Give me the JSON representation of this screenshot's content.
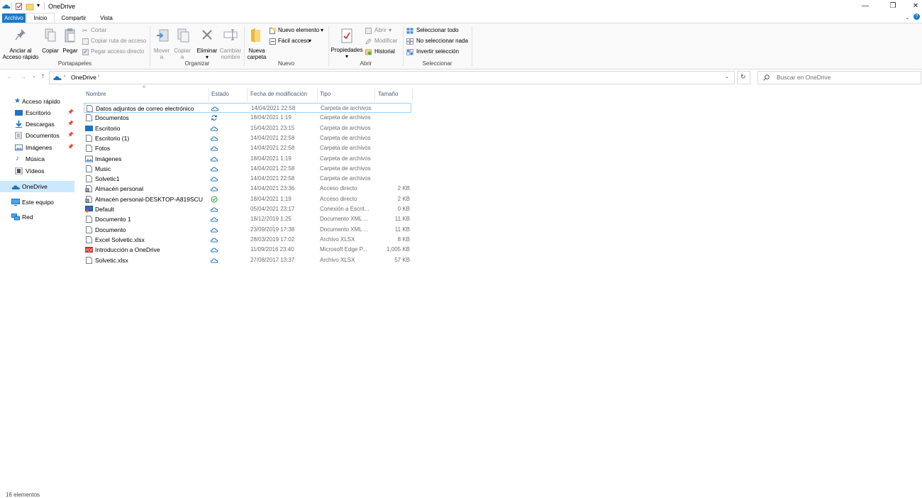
{
  "window": {
    "title": "OneDrive"
  },
  "tabs": {
    "file": "Archivo",
    "home": "Inicio",
    "share": "Compartir",
    "view": "Vista"
  },
  "ribbon": {
    "clipboard": {
      "label": "Portapapeles",
      "pin_line1": "Anclar al",
      "pin_line2": "Acceso rápido",
      "copy": "Copiar",
      "paste": "Pegar",
      "cut": "Cortar",
      "copy_path": "Copiar ruta de acceso",
      "paste_shortcut": "Pegar acceso directo"
    },
    "organize": {
      "label": "Organizar",
      "move_line1": "Mover",
      "move_line2": "a",
      "copy_line1": "Copiar",
      "copy_line2": "a",
      "delete": "Eliminar",
      "rename_line1": "Cambiar",
      "rename_line2": "nombre"
    },
    "new": {
      "label": "Nuevo",
      "folder_line1": "Nueva",
      "folder_line2": "carpeta",
      "new_item": "Nuevo elemento",
      "easy_access": "Fácil acceso"
    },
    "open": {
      "label": "Abrir",
      "properties": "Propiedades",
      "open": "Abrir",
      "edit": "Modificar",
      "history": "Historial"
    },
    "select": {
      "label": "Seleccionar",
      "select_all": "Seleccionar todo",
      "select_none": "No seleccionar nada",
      "invert": "Invertir selección"
    }
  },
  "address": {
    "path": "OneDrive",
    "search_placeholder": "Buscar en OneDrive"
  },
  "sidebar": {
    "quick_access": "Acceso rápido",
    "items": [
      {
        "label": "Escritorio",
        "icon": "desktop-icon",
        "pinned": true
      },
      {
        "label": "Descargas",
        "icon": "download-icon",
        "pinned": true
      },
      {
        "label": "Documentos",
        "icon": "documents-icon",
        "pinned": true
      },
      {
        "label": "Imágenes",
        "icon": "pictures-icon",
        "pinned": true
      },
      {
        "label": "Música",
        "icon": "music-icon",
        "pinned": false
      },
      {
        "label": "Vídeos",
        "icon": "videos-icon",
        "pinned": false
      }
    ],
    "onedrive": "OneDrive",
    "this_pc": "Este equipo",
    "network": "Red"
  },
  "columns": {
    "name": "Nombre",
    "status": "Estado",
    "modified": "Fecha de modificación",
    "type": "Tipo",
    "size": "Tamaño"
  },
  "files": [
    {
      "name": "Datos adjuntos de correo electrónico",
      "status": "cloud",
      "date": "14/04/2021 22:58",
      "type": "Carpeta de archivos",
      "size": "",
      "icon": "doc"
    },
    {
      "name": "Documentos",
      "status": "sync",
      "date": "18/04/2021 1:19",
      "type": "Carpeta de archivos",
      "size": "",
      "icon": "doc"
    },
    {
      "name": "Escritorio",
      "status": "cloud",
      "date": "15/04/2021 23:15",
      "type": "Carpeta de archivos",
      "size": "",
      "icon": "desktop"
    },
    {
      "name": "Escritorio (1)",
      "status": "cloud",
      "date": "14/04/2021 22:58",
      "type": "Carpeta de archivos",
      "size": "",
      "icon": "doc"
    },
    {
      "name": "Fotos",
      "status": "cloud",
      "date": "14/04/2021 22:58",
      "type": "Carpeta de archivos",
      "size": "",
      "icon": "doc"
    },
    {
      "name": "Imágenes",
      "status": "cloud",
      "date": "18/04/2021 1:19",
      "type": "Carpeta de archivos",
      "size": "",
      "icon": "pictures"
    },
    {
      "name": "Music",
      "status": "cloud",
      "date": "14/04/2021 22:58",
      "type": "Carpeta de archivos",
      "size": "",
      "icon": "doc"
    },
    {
      "name": "Solvetic1",
      "status": "cloud",
      "date": "14/04/2021 22:58",
      "type": "Carpeta de archivos",
      "size": "",
      "icon": "doc"
    },
    {
      "name": "Almacén personal",
      "status": "cloud",
      "date": "14/04/2021 23:36",
      "type": "Acceso directo",
      "size": "2 KB",
      "icon": "shortcut"
    },
    {
      "name": "Almacén personal-DESKTOP-A819SCU",
      "status": "ok",
      "date": "18/04/2021 1:19",
      "type": "Acceso directo",
      "size": "2 KB",
      "icon": "shortcut"
    },
    {
      "name": "Default",
      "status": "cloud",
      "date": "05/04/2021 23:17",
      "type": "Conexión a Escrit...",
      "size": "0 KB",
      "icon": "rdp"
    },
    {
      "name": "Documento 1",
      "status": "cloud",
      "date": "18/12/2019 1:25",
      "type": "Documento XML ...",
      "size": "11 KB",
      "icon": "doc"
    },
    {
      "name": "Documento",
      "status": "cloud",
      "date": "23/09/2019 17:38",
      "type": "Documento XML ...",
      "size": "11 KB",
      "icon": "doc"
    },
    {
      "name": "Excel Solvetic.xlsx",
      "status": "cloud",
      "date": "28/03/2019 17:02",
      "type": "Archivo XLSX",
      "size": "8 KB",
      "icon": "doc"
    },
    {
      "name": "Introducción a OneDrive",
      "status": "cloud",
      "date": "11/09/2016 23:40",
      "type": "Microsoft Edge P...",
      "size": "1,005 KB",
      "icon": "pdf"
    },
    {
      "name": "Solvetic.xlsx",
      "status": "cloud",
      "date": "27/08/2017 13:37",
      "type": "Archivo XLSX",
      "size": "57 KB",
      "icon": "doc"
    }
  ],
  "colors": {
    "accent": "#1979ca",
    "cloud": "#1a73c6",
    "selected": "#e5f3ff",
    "nav_selected": "#cce8ff"
  },
  "status_bar": {
    "text": "16 elementos"
  }
}
